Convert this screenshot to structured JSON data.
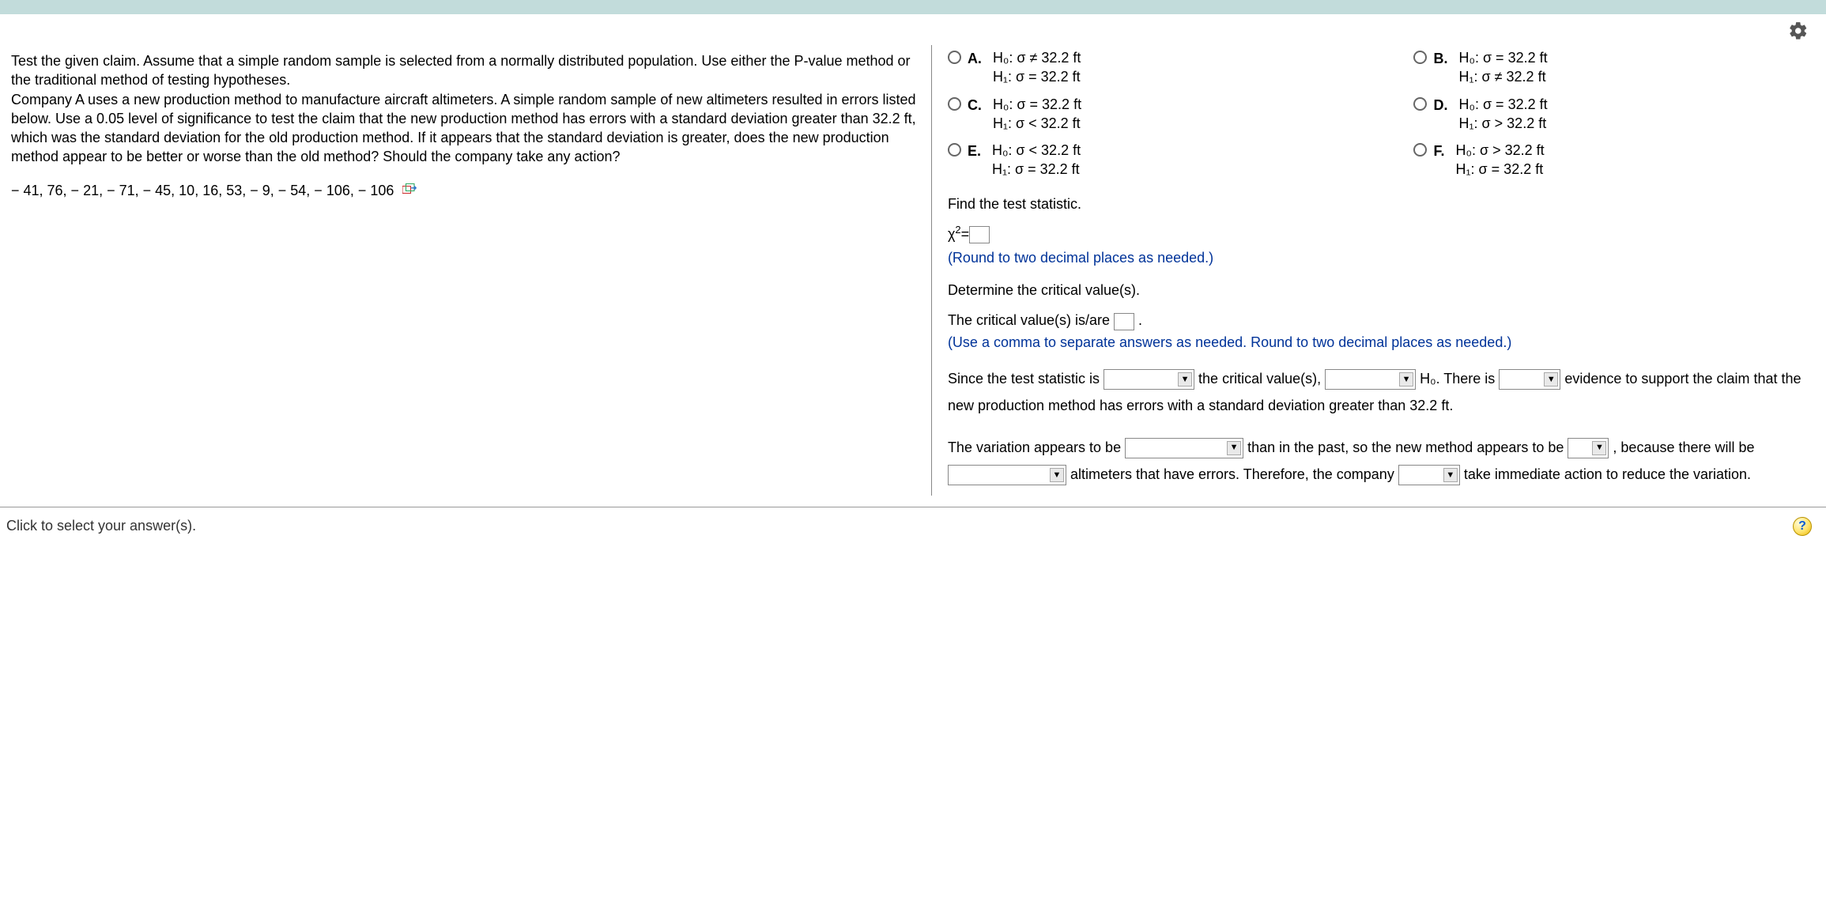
{
  "question": {
    "paragraph1": "Test the given claim. Assume that a simple random sample is selected from a normally distributed population. Use either the P-value method or the traditional method of testing hypotheses.",
    "paragraph2": "Company A uses a new production method to manufacture aircraft altimeters. A simple random sample of new altimeters resulted in errors listed below. Use a 0.05 level of significance to test the claim that the new production method has errors with a standard deviation greater than 32.2 ft, which was the standard deviation for the old production method. If it appears that the standard deviation is greater, does the new production method appear to be better or worse than the old method? Should the company take any action?",
    "data": "− 41, 76,  − 21,  − 71,  − 45, 10, 16, 53,  − 9,  − 54,  − 106,  − 106"
  },
  "options": {
    "A": {
      "h0": "H₀: σ ≠ 32.2 ft",
      "h1": "H₁: σ = 32.2 ft"
    },
    "B": {
      "h0": "H₀: σ = 32.2 ft",
      "h1": "H₁: σ ≠ 32.2 ft"
    },
    "C": {
      "h0": "H₀: σ = 32.2 ft",
      "h1": "H₁: σ < 32.2 ft"
    },
    "D": {
      "h0": "H₀: σ = 32.2 ft",
      "h1": "H₁: σ > 32.2 ft"
    },
    "E": {
      "h0": "H₀: σ < 32.2 ft",
      "h1": "H₁: σ = 32.2 ft"
    },
    "F": {
      "h0": "H₀: σ > 32.2 ft",
      "h1": "H₁: σ = 32.2 ft"
    }
  },
  "prompts": {
    "find_stat": "Find the test statistic.",
    "chi_label": "χ",
    "chi_equals": " = ",
    "round_note": "(Round to two decimal places as needed.)",
    "det_crit": "Determine the critical value(s).",
    "crit_pre": "The critical value(s) is/are ",
    "crit_post": ".",
    "crit_note": "(Use a comma to separate answers as needed. Round to two decimal places as needed.)"
  },
  "conclusion": {
    "c1": "Since the test statistic is",
    "c2": "the critical value(s),",
    "c3": "H₀. There is",
    "c4": "evidence to support the claim that the new production method has errors with a standard deviation greater than 32.2 ft."
  },
  "variation": {
    "v1": "The variation appears to be",
    "v2": "than in the past, so the new method appears to be",
    "v3": ", because there will be",
    "v4": "altimeters that have errors. Therefore, the company",
    "v5": "take immediate action to reduce the variation."
  },
  "footer": {
    "prompt": "Click to select your answer(s).",
    "help": "?"
  }
}
